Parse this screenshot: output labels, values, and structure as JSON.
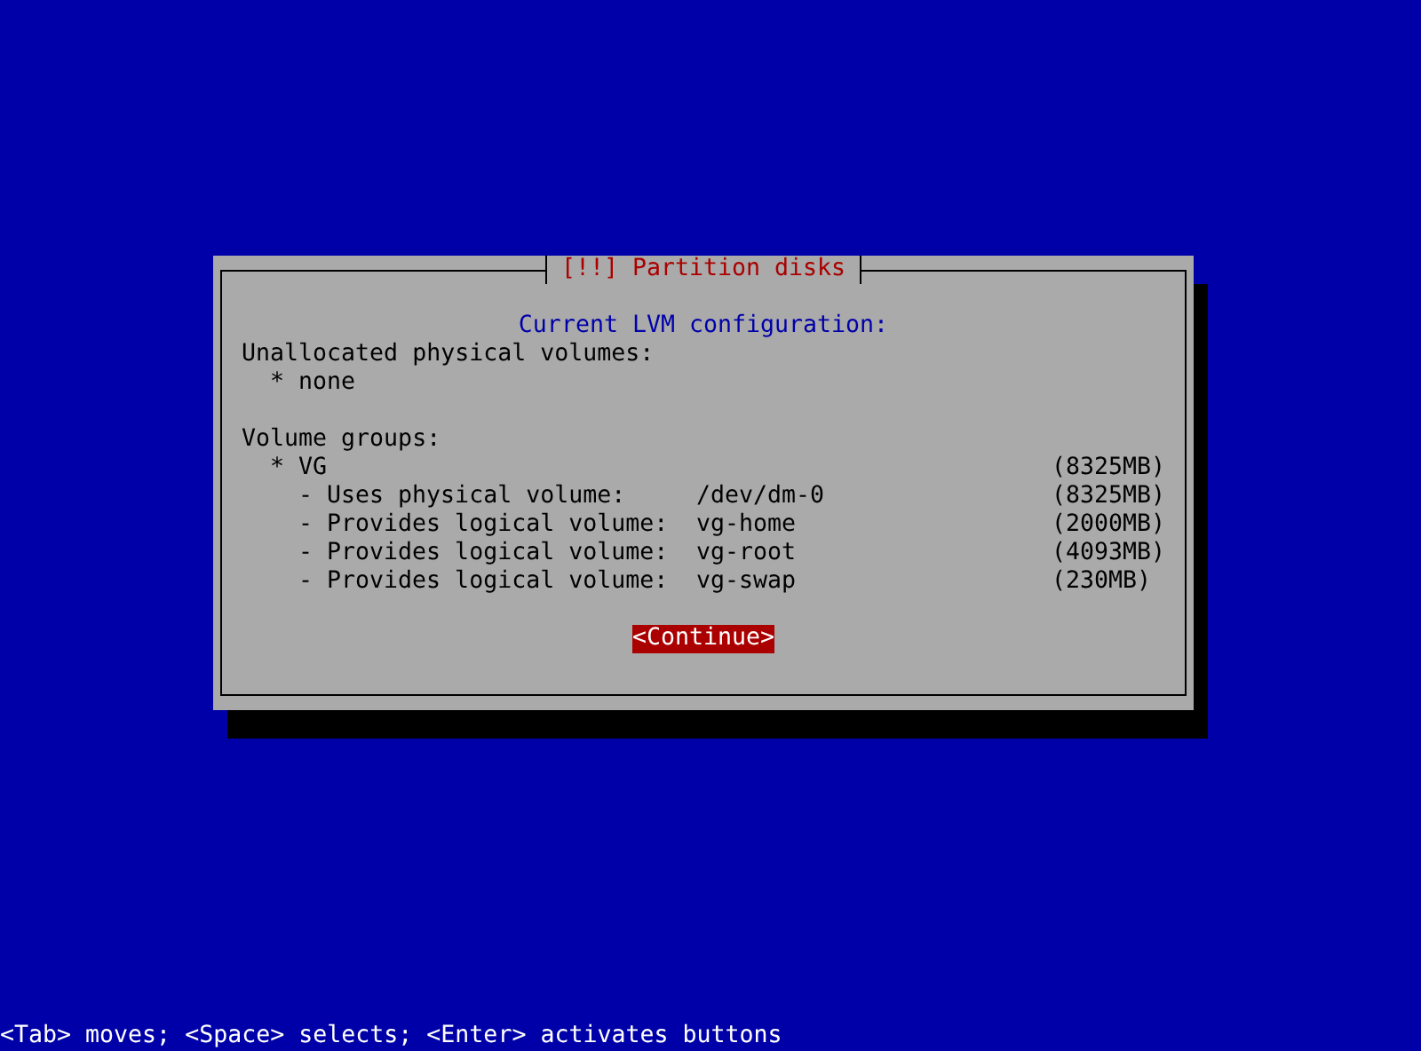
{
  "dialog": {
    "title": "[!!] Partition disks",
    "heading": "Current LVM configuration:",
    "unallocated": {
      "label": "Unallocated physical volumes:",
      "items": [
        "* none"
      ]
    },
    "volume_groups": {
      "label": "Volume groups:",
      "groups": [
        {
          "name": "* VG",
          "size": "(8325MB)",
          "children": [
            {
              "text": "- Uses physical volume:",
              "value": "/dev/dm-0",
              "size": "(8325MB)"
            },
            {
              "text": "- Provides logical volume:",
              "value": "vg-home",
              "size": "(2000MB)"
            },
            {
              "text": "- Provides logical volume:",
              "value": "vg-root",
              "size": "(4093MB)"
            },
            {
              "text": "- Provides logical volume:",
              "value": "vg-swap",
              "size": "(230MB)"
            }
          ]
        }
      ]
    },
    "buttons": [
      {
        "label": "<Continue>",
        "selected": true
      }
    ]
  },
  "status_bar": "<Tab> moves; <Space> selects; <Enter> activates buttons"
}
